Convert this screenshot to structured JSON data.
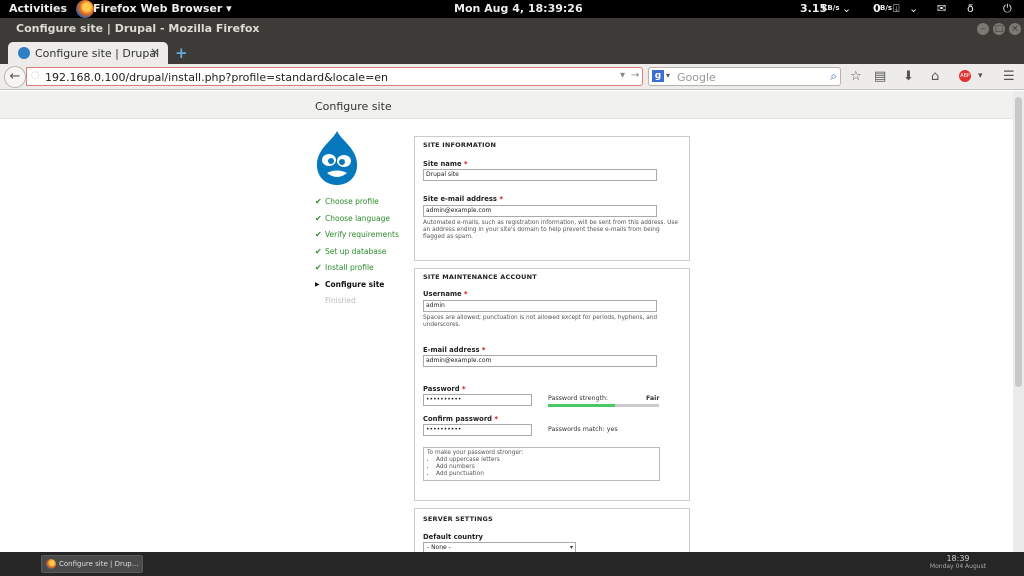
{
  "topbar": {
    "activities": "Activities",
    "app_menu": "Firefox Web Browser ▾",
    "clock": "Mon Aug  4, 18:39:26",
    "net_down": "3.15",
    "net_down_unit": "KB/s",
    "net_up": "0",
    "net_up_unit": "B/s"
  },
  "window": {
    "title": "Configure site | Drupal - Mozilla Firefox"
  },
  "tabs": [
    {
      "label": "Configure site | Drupal"
    }
  ],
  "navbar": {
    "url": "192.168.0.100/drupal/install.php?profile=standard&locale=en",
    "search_engine_icon": "google-icon",
    "search_placeholder": "Google"
  },
  "page": {
    "title": "Configure site",
    "steps": [
      {
        "label": "Choose profile",
        "state": "done"
      },
      {
        "label": "Choose language",
        "state": "done"
      },
      {
        "label": "Verify requirements",
        "state": "done"
      },
      {
        "label": "Set up database",
        "state": "done"
      },
      {
        "label": "Install profile",
        "state": "done"
      },
      {
        "label": "Configure site",
        "state": "current"
      },
      {
        "label": "Finished",
        "state": "pending"
      }
    ],
    "site_info": {
      "legend": "SITE INFORMATION",
      "site_name_label": "Site name",
      "site_name_value": "Drupal site",
      "email_label": "Site e-mail address",
      "email_value": "admin@example.com",
      "email_desc": "Automated e-mails, such as registration information, will be sent from this address. Use an address ending in your site's domain to help prevent these e-mails from being flagged as spam."
    },
    "maintenance": {
      "legend": "SITE MAINTENANCE ACCOUNT",
      "username_label": "Username",
      "username_value": "admin",
      "username_desc": "Spaces are allowed; punctuation is not allowed except for periods, hyphens, and underscores.",
      "email_label": "E-mail address",
      "email_value": "admin@example.com",
      "password_label": "Password",
      "password_value": "••••••••••",
      "strength_label": "Password strength:",
      "strength_value": "Fair",
      "strength_level": 0.6,
      "confirm_label": "Confirm password",
      "confirm_value": "••••••••••",
      "match_text": "Passwords match: yes",
      "tips_title": "To make your password stronger:",
      "tips": [
        "Add uppercase letters",
        "Add numbers",
        "Add punctuation"
      ]
    },
    "server": {
      "legend": "SERVER SETTINGS",
      "country_label": "Default country",
      "country_value": "- None -"
    }
  },
  "taskbar": {
    "item": "Configure site | Drup...",
    "time": "18:39",
    "date": "Monday 04 August"
  },
  "colors": {
    "drupal_blue": "#0678be",
    "step_done": "#2c8a2c",
    "strength_fill": "#47c965",
    "required": "#cc0000"
  }
}
